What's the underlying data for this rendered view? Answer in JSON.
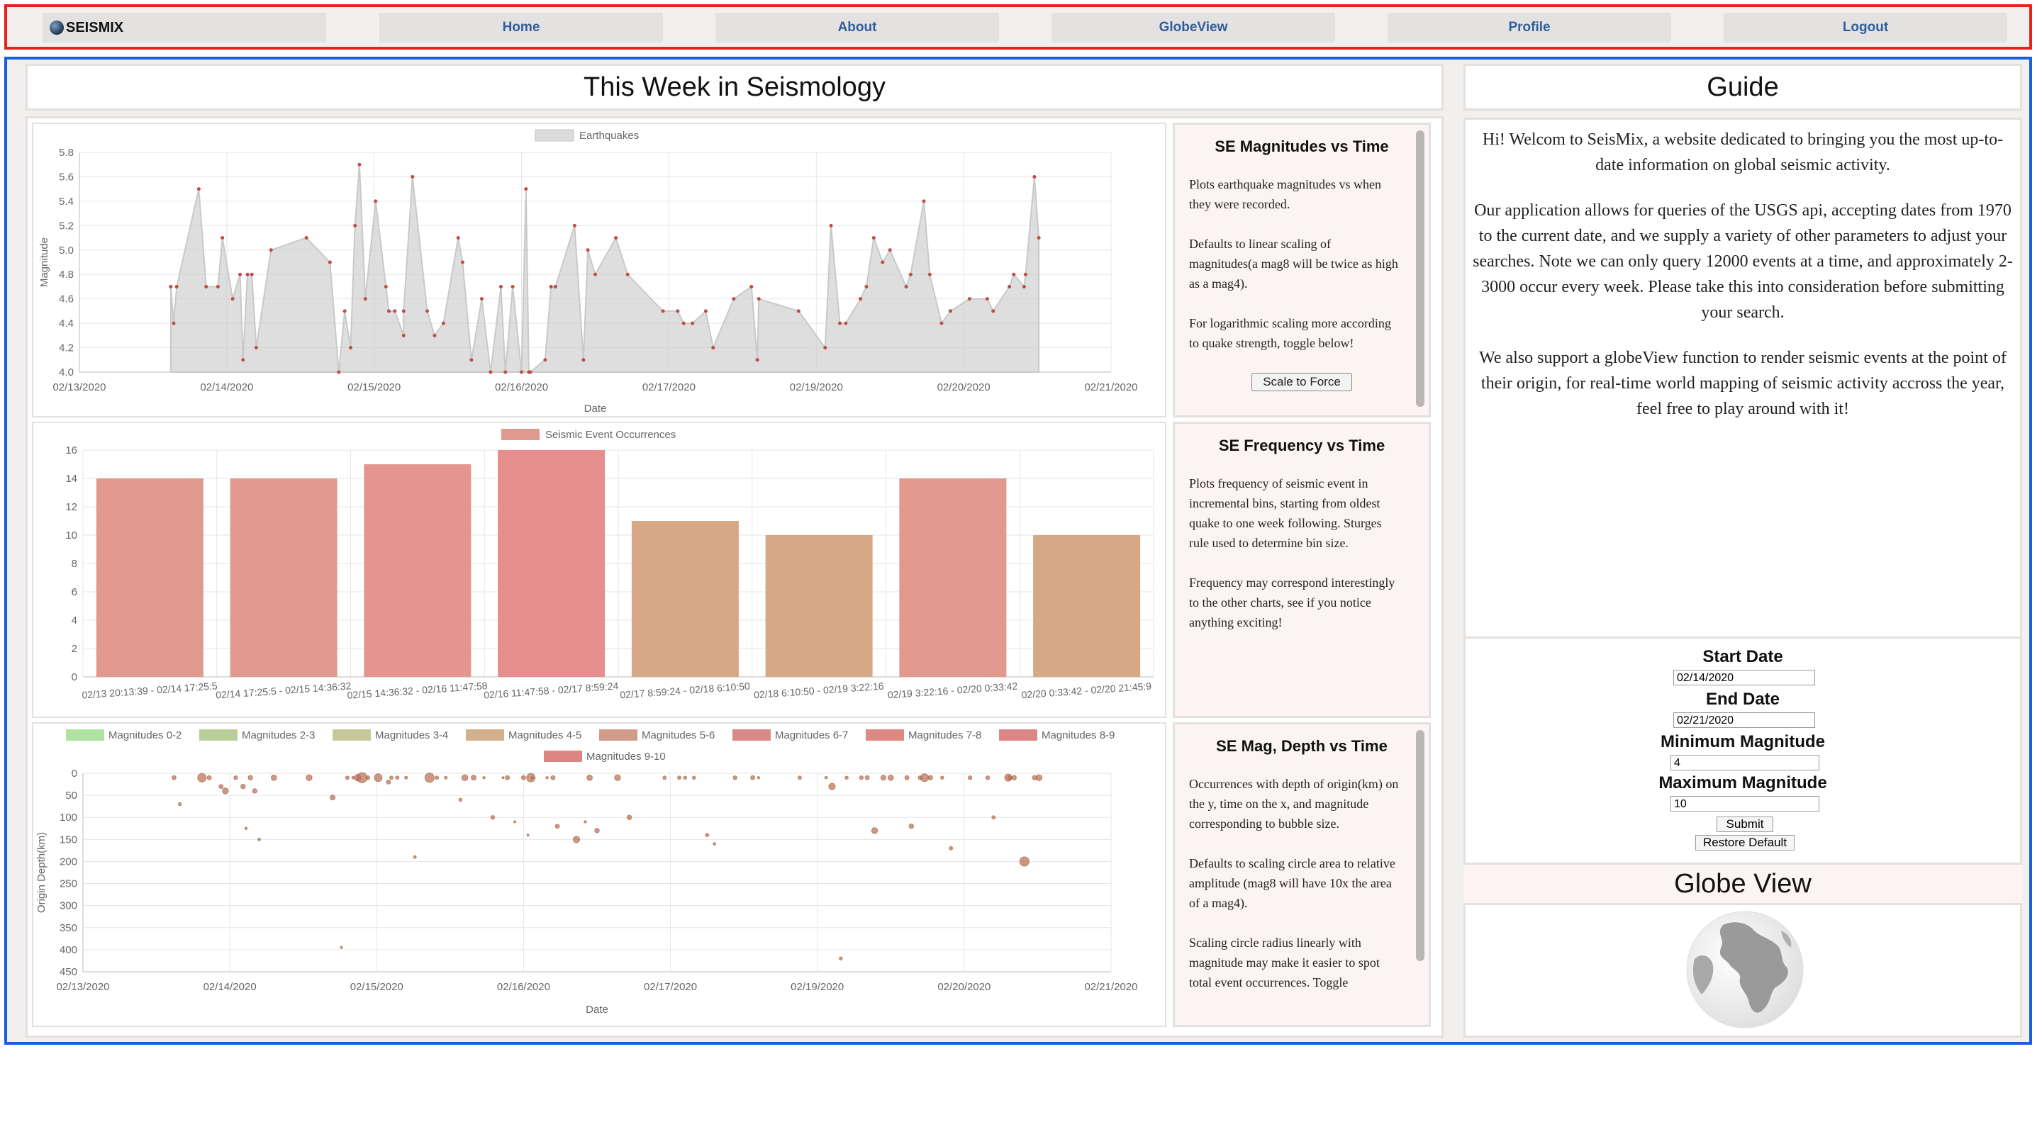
{
  "nav": {
    "logo": "SEISMIX",
    "links": [
      "Home",
      "About",
      "GlobeView",
      "Profile",
      "Logout"
    ]
  },
  "main_title": "This Week in Seismology",
  "guide": {
    "title": "Guide",
    "paragraphs": [
      "Hi! Welcom to SeisMix, a website dedicated to bringing you the most up-to-date information on global seismic activity.",
      "Our application allows for queries of the USGS api, accepting dates from 1970 to the current date, and we supply a variety of other parameters to adjust your searches. Note we can only query 12000 events at a time, and approximately 2-3000 occur every week. Please take this into consideration before submitting your search.",
      "We also support a globeView function to render seismic events at the point of their origin, for real-time world mapping of seismic activity accross the year, feel free to play around with it!"
    ]
  },
  "form": {
    "start_label": "Start Date",
    "start_value": "02/14/2020",
    "end_label": "End Date",
    "end_value": "02/21/2020",
    "min_label": "Minimum Magnitude",
    "min_value": "4",
    "max_label": "Maximum Magnitude",
    "max_value": "10",
    "submit": "Submit",
    "restore": "Restore Default"
  },
  "globe_title": "Globe View",
  "desc1": {
    "title": "SE Magnitudes vs Time",
    "p": [
      "Plots earthquake magnitudes vs when they were recorded.",
      "Defaults to linear scaling of magnitudes(a mag8 will be twice as high as a mag4).",
      "For logarithmic scaling more according to quake strength, toggle below!"
    ],
    "button": "Scale to Force"
  },
  "desc2": {
    "title": "SE Frequency vs Time",
    "p": [
      "Plots frequency of seismic event in incremental bins, starting from oldest quake to one week following. Sturges rule used to determine bin size.",
      "Frequency may correspond interestingly to the other charts, see if you notice anything exciting!"
    ]
  },
  "desc3": {
    "title": "SE Mag, Depth vs Time",
    "p": [
      "Occurrences with depth of origin(km) on the y, time on the x, and magnitude corresponding to bubble size.",
      "Defaults to scaling circle area to relative amplitude (mag8 will have 10x the area of a mag4).",
      "Scaling circle radius linearly with magnitude may make it easier to spot total event occurrences. Toggle"
    ]
  },
  "chart_data": [
    {
      "type": "area",
      "legend": [
        "Earthquakes"
      ],
      "xlabel": "Date",
      "ylabel": "Magnitude",
      "xticks": [
        "02/13/2020",
        "02/14/2020",
        "02/15/2020",
        "02/16/2020",
        "02/17/2020",
        "02/19/2020",
        "02/20/2020",
        "02/21/2020"
      ],
      "yticks": [
        "4.0",
        "4.2",
        "4.4",
        "4.6",
        "4.8",
        "5.0",
        "5.2",
        "5.4",
        "5.6",
        "5.8"
      ],
      "ylim": [
        4.0,
        5.8
      ],
      "xlim": [
        0,
        7
      ],
      "series": [
        {
          "x": [
            0.62,
            0.64,
            0.66,
            0.81,
            0.86,
            0.94,
            0.97,
            1.04,
            1.09,
            1.11,
            1.14,
            1.17,
            1.2,
            1.3,
            1.54,
            1.7,
            1.76,
            1.8,
            1.84,
            1.87,
            1.9,
            1.94,
            2.01,
            2.08,
            2.1,
            2.14,
            2.2,
            2.2,
            2.26,
            2.36,
            2.41,
            2.47,
            2.57,
            2.6,
            2.66,
            2.73,
            2.79,
            2.86,
            2.89,
            2.94,
            3.0,
            3.03,
            3.05,
            3.06,
            3.16,
            3.2,
            3.23,
            3.36,
            3.42,
            3.45,
            3.5,
            3.64,
            3.72,
            3.96,
            4.06,
            4.1,
            4.16,
            4.25,
            4.3,
            4.44,
            4.56,
            4.6,
            4.6,
            4.61,
            4.88,
            5.06,
            5.1,
            5.16,
            5.2,
            5.3,
            5.34,
            5.39,
            5.45,
            5.5,
            5.61,
            5.64,
            5.73,
            5.77,
            5.85,
            5.91,
            6.04,
            6.16,
            6.2,
            6.31,
            6.34,
            6.41,
            6.42,
            6.48,
            6.51
          ],
          "values": [
            4.7,
            4.4,
            4.7,
            5.5,
            4.7,
            4.7,
            5.1,
            4.6,
            4.8,
            4.1,
            4.8,
            4.8,
            4.2,
            5.0,
            5.1,
            4.9,
            4.0,
            4.5,
            4.2,
            5.2,
            5.7,
            4.6,
            5.4,
            4.7,
            4.5,
            4.5,
            4.3,
            4.5,
            5.6,
            4.5,
            4.3,
            4.4,
            5.1,
            4.9,
            4.1,
            4.6,
            4.0,
            4.7,
            4.0,
            4.7,
            4.0,
            5.5,
            4.0,
            4.0,
            4.1,
            4.7,
            4.7,
            5.2,
            4.1,
            5.0,
            4.8,
            5.1,
            4.8,
            4.5,
            4.5,
            4.4,
            4.4,
            4.5,
            4.2,
            4.6,
            4.7,
            4.1,
            4.1,
            4.6,
            4.5,
            4.2,
            5.2,
            4.4,
            4.4,
            4.6,
            4.7,
            5.1,
            4.9,
            5.0,
            4.7,
            4.8,
            5.4,
            4.8,
            4.4,
            4.5,
            4.6,
            4.6,
            4.5,
            4.7,
            4.8,
            4.7,
            4.8,
            5.6,
            5.1
          ]
        }
      ]
    },
    {
      "type": "bar",
      "legend": [
        "Seismic Event Occurrences"
      ],
      "categories": [
        "02/13 20:13:39 - 02/14 17:25:5",
        "02/14 17:25:5 - 02/15 14:36:32",
        "02/15 14:36:32 - 02/16 11:47:58",
        "02/16 11:47:58 - 02/17 8:59:24",
        "02/17 8:59:24 - 02/18 6:10:50",
        "02/18 6:10:50 - 02/19 3:22:16",
        "02/19 3:22:16 - 02/20 0:33:42",
        "02/20 0:33:42 - 02/20 21:45:9"
      ],
      "values": [
        14,
        14,
        15,
        16,
        11,
        10,
        14,
        10
      ],
      "colors": [
        "#e0998c",
        "#e0998c",
        "#e59590",
        "#e68d8e",
        "#d6a886",
        "#d6a886",
        "#e0998c",
        "#d6a886"
      ],
      "yticks": [
        "0",
        "2",
        "4",
        "6",
        "8",
        "10",
        "12",
        "14",
        "16"
      ],
      "ylim": [
        0,
        16
      ]
    },
    {
      "type": "scatter",
      "legend": [
        "Magnitudes 0-2",
        "Magnitudes 2-3",
        "Magnitudes 3-4",
        "Magnitudes 4-5",
        "Magnitudes 5-6",
        "Magnitudes 6-7",
        "Magnitudes 7-8",
        "Magnitudes 8-9",
        "Magnitudes 9-10"
      ],
      "legend_colors": [
        "#b0e2a0",
        "#b8cd98",
        "#c6c89a",
        "#d2b08e",
        "#d29c8a",
        "#d98a86",
        "#de8883",
        "#de8685",
        "#dd8584"
      ],
      "xlabel": "Date",
      "ylabel": "Origin Depth(km)",
      "xticks": [
        "02/13/2020",
        "02/14/2020",
        "02/15/2020",
        "02/16/2020",
        "02/17/2020",
        "02/19/2020",
        "02/20/2020",
        "02/21/2020"
      ],
      "yticks": [
        "0",
        "50",
        "100",
        "150",
        "200",
        "250",
        "300",
        "350",
        "400",
        "450"
      ],
      "ylim": [
        0,
        450
      ],
      "xlim": [
        0,
        7
      ],
      "series": [
        {
          "x": [
            0.62,
            0.66,
            0.81,
            0.86,
            0.94,
            0.97,
            1.04,
            1.09,
            1.11,
            1.14,
            1.17,
            1.2,
            1.3,
            1.54,
            1.7,
            1.76,
            1.8,
            1.84,
            1.87,
            1.9,
            1.94,
            2.01,
            2.08,
            2.1,
            2.14,
            2.2,
            2.26,
            2.36,
            2.41,
            2.47,
            2.57,
            2.6,
            2.66,
            2.73,
            2.79,
            2.86,
            2.89,
            2.94,
            3.0,
            3.03,
            3.05,
            3.06,
            3.16,
            3.2,
            3.23,
            3.36,
            3.42,
            3.45,
            3.5,
            3.64,
            3.72,
            3.96,
            4.06,
            4.1,
            4.16,
            4.25,
            4.3,
            4.44,
            4.56,
            4.6,
            4.88,
            5.06,
            5.1,
            5.16,
            5.2,
            5.3,
            5.34,
            5.39,
            5.45,
            5.5,
            5.61,
            5.64,
            5.73,
            5.77,
            5.85,
            5.91,
            6.04,
            6.16,
            6.2,
            6.31,
            6.34,
            6.41,
            6.48,
            6.51,
            6.3,
            5.7
          ],
          "y": [
            10,
            70,
            10,
            10,
            30,
            40,
            10,
            30,
            125,
            10,
            40,
            150,
            10,
            10,
            55,
            395,
            10,
            10,
            10,
            10,
            10,
            10,
            20,
            10,
            10,
            10,
            190,
            10,
            10,
            10,
            60,
            10,
            10,
            10,
            100,
            10,
            10,
            110,
            10,
            140,
            10,
            10,
            10,
            10,
            120,
            150,
            110,
            10,
            130,
            10,
            100,
            10,
            10,
            10,
            10,
            140,
            160,
            10,
            10,
            10,
            10,
            10,
            30,
            420,
            10,
            10,
            10,
            130,
            10,
            10,
            10,
            120,
            10,
            10,
            10,
            170,
            10,
            10,
            100,
            10,
            10,
            200,
            10,
            10,
            10,
            10
          ],
          "sizes": [
            4.7,
            4.4,
            5.5,
            4.7,
            4.7,
            5.1,
            4.6,
            4.8,
            4.1,
            4.8,
            4.8,
            4.2,
            5.0,
            5.1,
            4.9,
            4.0,
            4.5,
            4.2,
            5.2,
            5.7,
            4.6,
            5.4,
            4.7,
            4.5,
            4.5,
            4.3,
            4.3,
            5.6,
            4.5,
            4.3,
            4.4,
            5.1,
            4.9,
            4.1,
            4.6,
            4.0,
            4.7,
            4.0,
            4.7,
            4.0,
            5.5,
            4.0,
            4.1,
            4.7,
            4.7,
            5.2,
            4.1,
            5.0,
            4.8,
            5.1,
            4.8,
            4.5,
            4.5,
            4.4,
            4.4,
            4.5,
            4.2,
            4.6,
            4.7,
            4.1,
            4.5,
            4.2,
            5.2,
            4.4,
            4.4,
            4.6,
            4.7,
            5.1,
            4.9,
            5.0,
            4.7,
            4.8,
            5.4,
            4.8,
            4.4,
            4.5,
            4.6,
            4.6,
            4.5,
            4.7,
            4.8,
            5.6,
            4.8,
            5.1,
            5.3,
            4.6
          ]
        }
      ]
    }
  ]
}
